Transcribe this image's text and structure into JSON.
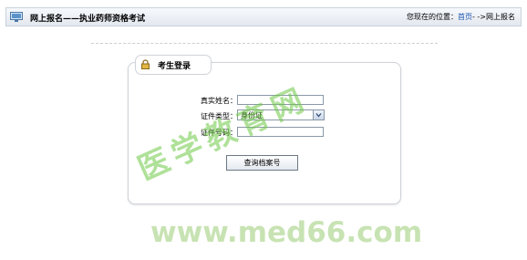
{
  "header": {
    "title": "网上报名——执业药师资格考试",
    "location_prefix": "您现在的位置：",
    "crumb_home": "首页",
    "crumb_sep": "- ->",
    "crumb_current": "网上报名"
  },
  "panel": {
    "tab_label": "考生登录",
    "fields": {
      "name_label": "真实姓名：",
      "name_value": "",
      "id_type_label": "证件类型：",
      "id_type_value": "身份证",
      "id_number_label": "证件号码：",
      "id_number_value": ""
    },
    "submit_label": "查询档案号"
  },
  "watermark": {
    "cn": "医学教育网",
    "url": "www.med66.com"
  },
  "colors": {
    "link": "#1a55b0",
    "watermark": "#9fd07a"
  }
}
